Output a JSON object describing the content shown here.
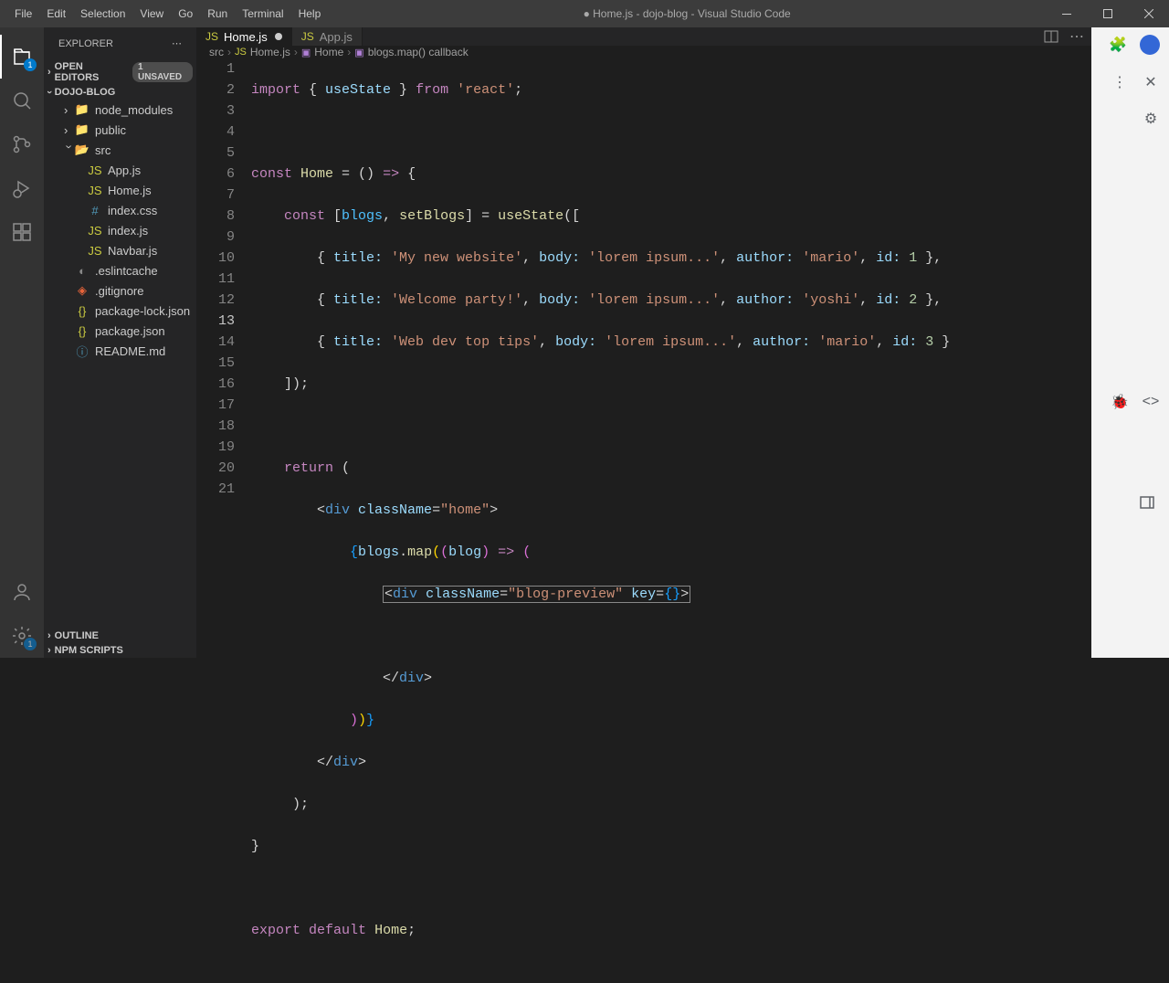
{
  "window": {
    "title": "● Home.js - dojo-blog - Visual Studio Code",
    "menu": [
      "File",
      "Edit",
      "Selection",
      "View",
      "Go",
      "Run",
      "Terminal",
      "Help"
    ]
  },
  "activityBar": {
    "explorer_badge": "1"
  },
  "explorer": {
    "title": "EXPLORER",
    "openEditors": {
      "label": "OPEN EDITORS",
      "badge": "1 UNSAVED"
    },
    "project": "DOJO-BLOG",
    "outline": "OUTLINE",
    "npm": "NPM SCRIPTS",
    "tree": {
      "node_modules": "node_modules",
      "public": "public",
      "src": "src",
      "app_js": "App.js",
      "home_js": "Home.js",
      "index_css": "index.css",
      "index_js": "index.js",
      "navbar_js": "Navbar.js",
      "eslintcache": ".eslintcache",
      "gitignore": ".gitignore",
      "package_lock": "package-lock.json",
      "package_json": "package.json",
      "readme": "README.md"
    }
  },
  "tabs": {
    "home": "Home.js",
    "app": "App.js"
  },
  "breadcrumbs": {
    "src": "src",
    "home_js": "Home.js",
    "home_fn": "Home",
    "callback": "blogs.map() callback"
  },
  "code": {
    "blogs": [
      {
        "title": "My new website",
        "body": "lorem ipsum...",
        "author": "mario",
        "id": 1
      },
      {
        "title": "Welcome party!",
        "body": "lorem ipsum...",
        "author": "yoshi",
        "id": 2
      },
      {
        "title": "Web dev top tips",
        "body": "lorem ipsum...",
        "author": "mario",
        "id": 3
      }
    ],
    "last_line": 21,
    "current_line": 13,
    "lines": {
      "l1": "import { useState } from 'react';",
      "l3": "const Home = () => {",
      "l4": "    const [blogs, setBlogs] = useState([",
      "l5": "        { title: 'My new website', body: 'lorem ipsum...', author: 'mario', id: 1 },",
      "l6": "        { title: 'Welcome party!', body: 'lorem ipsum...', author: 'yoshi', id: 2 },",
      "l7": "        { title: 'Web dev top tips', body: 'lorem ipsum...', author: 'mario', id: 3 }",
      "l8": "    ]);",
      "l10": "    return (",
      "l11": "        <div className=\"home\">",
      "l12": "            {blogs.map((blog) => (",
      "l13": "                <div className=\"blog-preview\" key={}>",
      "l15": "                </div>",
      "l16": "            ))}",
      "l17": "        </div>",
      "l18": "     );",
      "l19": "}",
      "l21": "export default Home;"
    }
  }
}
